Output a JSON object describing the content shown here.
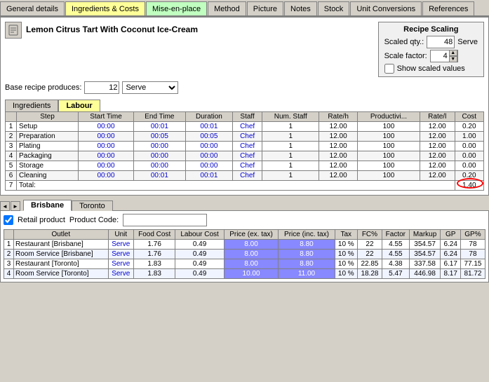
{
  "tabs": [
    {
      "label": "General details",
      "active": false,
      "color": "normal"
    },
    {
      "label": "Ingredients & Costs",
      "active": false,
      "color": "yellow"
    },
    {
      "label": "Mise-en-place",
      "active": false,
      "color": "green"
    },
    {
      "label": "Method",
      "active": false,
      "color": "normal"
    },
    {
      "label": "Picture",
      "active": false,
      "color": "normal"
    },
    {
      "label": "Notes",
      "active": false,
      "color": "normal"
    },
    {
      "label": "Stock",
      "active": false,
      "color": "normal"
    },
    {
      "label": "Unit Conversions",
      "active": false,
      "color": "normal"
    },
    {
      "label": "References",
      "active": false,
      "color": "normal"
    }
  ],
  "recipe": {
    "title": "Lemon Citrus Tart With Coconut Ice-Cream",
    "scaling": {
      "title": "Recipe Scaling",
      "scaled_qty_label": "Scaled qty.:",
      "scaled_qty_value": "48",
      "serve_label": "Serve",
      "scale_factor_label": "Scale factor:",
      "scale_factor_value": "4",
      "show_scaled_label": "Show scaled values"
    },
    "base_produces_label": "Base recipe produces:",
    "base_qty": "12",
    "base_unit": "Serve"
  },
  "sub_tabs": [
    {
      "label": "Ingredients",
      "active": false
    },
    {
      "label": "Labour",
      "active": true
    }
  ],
  "labour_table": {
    "headers": [
      "",
      "Step",
      "Start Time",
      "End Time",
      "Duration",
      "Staff",
      "Num. Staff",
      "Rate/h",
      "Productivity",
      "Adj. Rate/l",
      "Cost"
    ],
    "rows": [
      {
        "num": "1",
        "step": "Setup",
        "start": "00:00",
        "end": "00:01",
        "duration": "00:01",
        "staff": "Chef",
        "num_staff": "1",
        "rate": "12.00",
        "productivity": "100",
        "adj_rate": "12.00",
        "cost": "0.20"
      },
      {
        "num": "2",
        "step": "Preparation",
        "start": "00:00",
        "end": "00:05",
        "duration": "00:05",
        "staff": "Chef",
        "num_staff": "1",
        "rate": "12.00",
        "productivity": "100",
        "adj_rate": "12.00",
        "cost": "1.00"
      },
      {
        "num": "3",
        "step": "Plating",
        "start": "00:00",
        "end": "00:00",
        "duration": "00:00",
        "staff": "Chef",
        "num_staff": "1",
        "rate": "12.00",
        "productivity": "100",
        "adj_rate": "12.00",
        "cost": "0.00"
      },
      {
        "num": "4",
        "step": "Packaging",
        "start": "00:00",
        "end": "00:00",
        "duration": "00:00",
        "staff": "Chef",
        "num_staff": "1",
        "rate": "12.00",
        "productivity": "100",
        "adj_rate": "12.00",
        "cost": "0.00"
      },
      {
        "num": "5",
        "step": "Storage",
        "start": "00:00",
        "end": "00:00",
        "duration": "00:00",
        "staff": "Chef",
        "num_staff": "1",
        "rate": "12.00",
        "productivity": "100",
        "adj_rate": "12.00",
        "cost": "0.00"
      },
      {
        "num": "6",
        "step": "Cleaning",
        "start": "00:00",
        "end": "00:01",
        "duration": "00:01",
        "staff": "Chef",
        "num_staff": "1",
        "rate": "12.00",
        "productivity": "100",
        "adj_rate": "12.00",
        "cost": "0.20"
      },
      {
        "num": "7",
        "step": "Total:",
        "start": "",
        "end": "",
        "duration": "",
        "staff": "",
        "num_staff": "",
        "rate": "",
        "productivity": "",
        "adj_rate": "",
        "cost": "1.40"
      }
    ]
  },
  "city_tabs": [
    {
      "label": "Brisbane",
      "active": true
    },
    {
      "label": "Toronto",
      "active": false
    }
  ],
  "lower": {
    "retail_label": "Retail product",
    "product_code_label": "Product Code:",
    "pricing_headers": [
      "",
      "Outlet",
      "Unit",
      "Food Cost",
      "Labour Cost",
      "Price (ex. tax)",
      "Price (inc. tax)",
      "Tax",
      "FC%",
      "Factor",
      "Markup",
      "GP",
      "GP%"
    ],
    "pricing_rows": [
      {
        "num": "1",
        "outlet": "Restaurant [Brisbane]",
        "unit": "Serve",
        "food_cost": "1.76",
        "labour_cost": "0.49",
        "price_ex": "8.00",
        "price_inc": "8.80",
        "tax": "10 %",
        "fc": "22",
        "factor": "4.55",
        "markup": "354.57",
        "gp": "6.24",
        "gp_pct": "78"
      },
      {
        "num": "2",
        "outlet": "Room Service [Brisbane]",
        "unit": "Serve",
        "food_cost": "1.76",
        "labour_cost": "0.49",
        "price_ex": "8.00",
        "price_inc": "8.80",
        "tax": "10 %",
        "fc": "22",
        "factor": "4.55",
        "markup": "354.57",
        "gp": "6.24",
        "gp_pct": "78"
      },
      {
        "num": "3",
        "outlet": "Restaurant [Toronto]",
        "unit": "Serve",
        "food_cost": "1.83",
        "labour_cost": "0.49",
        "price_ex": "8.00",
        "price_inc": "8.80",
        "tax": "10 %",
        "fc": "22.85",
        "factor": "4.38",
        "markup": "337.58",
        "gp": "6.17",
        "gp_pct": "77.15"
      },
      {
        "num": "4",
        "outlet": "Room Service [Toronto]",
        "unit": "Serve",
        "food_cost": "1.83",
        "labour_cost": "0.49",
        "price_ex": "10.00",
        "price_inc": "11.00",
        "tax": "10 %",
        "fc": "18.28",
        "factor": "5.47",
        "markup": "446.98",
        "gp": "8.17",
        "gp_pct": "81.72"
      }
    ]
  },
  "icons": {
    "recipe": "📋",
    "check": "✓",
    "up_arrow": "▲",
    "down_arrow": "▼",
    "left": "◄",
    "right": "►",
    "prev": "◄",
    "next": "►"
  }
}
